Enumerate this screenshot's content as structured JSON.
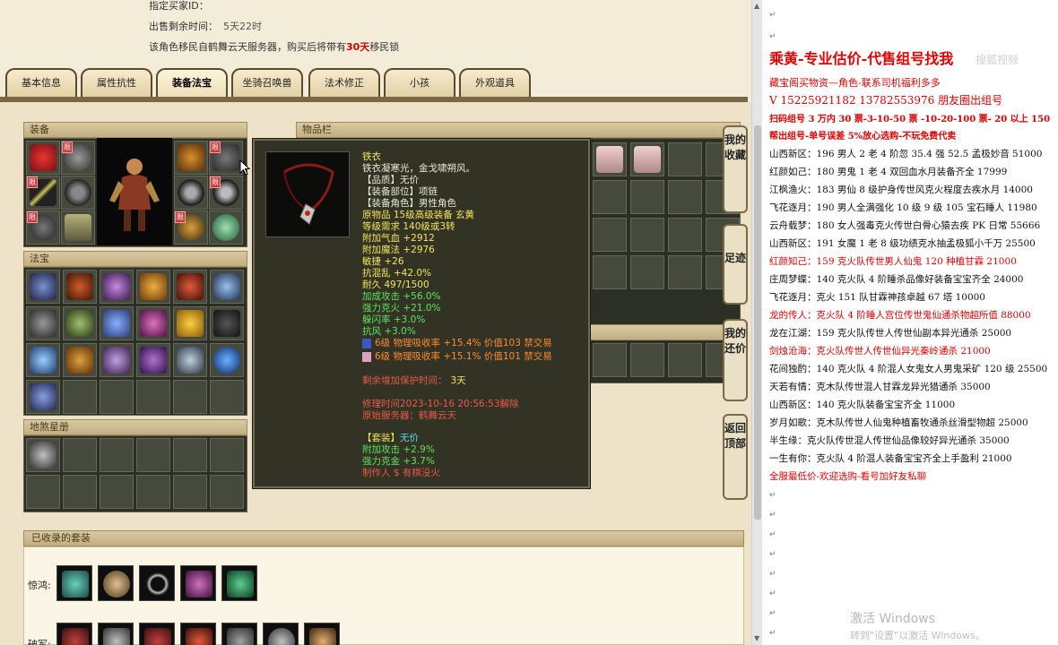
{
  "header": {
    "line0": "指定买家ID：",
    "sale_time_label": "出售剩余时间：",
    "sale_time_value": "5天22时",
    "migrate_pre": "该角色移民自鹤舞云天服务器，购买后将带有",
    "migrate_days": "30天",
    "migrate_post": "移民锁"
  },
  "tabs": [
    {
      "label": "基本信息",
      "active": false
    },
    {
      "label": "属性抗性",
      "active": false
    },
    {
      "label": "装备法宝",
      "active": true
    },
    {
      "label": "坐骑召唤兽",
      "active": false
    },
    {
      "label": "法术修正",
      "active": false
    },
    {
      "label": "小孩",
      "active": false
    },
    {
      "label": "外观道具",
      "active": false
    }
  ],
  "panels": {
    "equipment": "装备",
    "fabao": "法宝",
    "star": "地煞星册",
    "items": "物品栏",
    "suits": "已收录的套装",
    "limit_tag": "限"
  },
  "side_buttons": [
    "我的收藏",
    "足迹",
    "我的还价",
    "返回顶部"
  ],
  "tooltip": {
    "name": "铁衣",
    "desc": "铁衣凝寒光，金戈啸朔风。",
    "quality": "【品质】无价",
    "part": "【装备部位】项链",
    "role": "【装备角色】男性角色",
    "origin": "原物品 15级高级装备 玄黄",
    "level_req": "等级需求 140级或3转",
    "hp": "附加气血 +2912",
    "mp": "附加魔法 +2976",
    "agi": "敏捷 +26",
    "res_chaos": "抗混乱 +42.0%",
    "durability": "耐久 497/1500",
    "atk": "加成攻击 +56.0%",
    "fire": "强力克火 +21.0%",
    "dodge": "躲闪率 +3.0%",
    "wind": "抗风 +3.0%",
    "gem1": "6级 物理吸收率 +15.4% 价值103 禁交易",
    "gem2": "6级 物理吸收率 +15.1% 价值101 禁交易",
    "protect_label": "剩余增加保护时间：",
    "protect_value": "3天",
    "repair_time": "修理时间2023-10-16 20:56:53解除",
    "server": "原始服务器：鹤舞云天",
    "set_label": "【套装】",
    "set_value": "无价",
    "set_atk": "附加攻击 +2.9%",
    "set_gold": "强力克金 +3.7%",
    "maker": "制作人 $ 有棋没火"
  },
  "suits": {
    "row1_label": "惊鸿:",
    "row2_label": "破军:"
  },
  "overlay": {
    "title": "乘黄-专业估价-代售组号找我",
    "sub1": "藏宝阁买物资—角色-联系司机福利多多",
    "sub2": "V 15225921182   13782553976 朋友圈出组号",
    "sub3": "扫码组号 3 万内 30 票-3-10-50 票 -10-20-100 票- 20 以上 150",
    "sub4": "帮出组号-单号误差 5%放心选购-不玩免费代卖",
    "lines": [
      {
        "text": "山西新区：196 男人 2 老 4 阶忽 35.4 强 52.5 孟极妙音 51000",
        "red": false
      },
      {
        "text": "红颜如己：180 男鬼 1 老 4 双回血水月装备齐全 17999",
        "red": false
      },
      {
        "text": "江枫渔火：183 男仙 8 级护身传世风克火程度去疾水月 14000",
        "red": false
      },
      {
        "text": "飞花逐月：190 男人全满强化 10 级 9 级 105 宝石睡人 11980",
        "red": false
      },
      {
        "text": "云舟载梦：180 女人强毒克火传世白骨心猿去疾 PK 日常 55666",
        "red": false
      },
      {
        "text": "山西新区：191 女魔 1 老 8 级功绩克水抽孟极狐小千万 25500",
        "red": false
      },
      {
        "text": "红颜知己：159 克火队传世男人仙鬼 120 种植甘霖 21000",
        "red": true
      },
      {
        "text": "庄周梦蝶：140 克火队 4 阶睡杀品像好装备宝宝齐全 24000",
        "red": false
      },
      {
        "text": "飞花逐月：克火 151 队甘霖神孩卓越 67 塔 10000",
        "red": false
      },
      {
        "text": "龙的传人：克火队 4 阶睡人宫位传世鬼仙通杀物超所值 88000",
        "red": true
      },
      {
        "text": "龙在江湖：159 克火队传世人传世仙副本异光通杀 25000",
        "red": false
      },
      {
        "text": "剑烛沧海：克火队传世人传世仙异光秦岭通杀 21000",
        "red": true
      },
      {
        "text": "花间独酌：140 克火队 4 阶混人女鬼女人男鬼采矿 120 级 25500",
        "red": false
      },
      {
        "text": "天若有情：克木队传世混人甘霖龙异光猎通杀 35000",
        "red": false
      },
      {
        "text": "山西新区：140 克火队装备宝宝齐全 11000",
        "red": false
      },
      {
        "text": "岁月如歌：克木队传世人仙鬼种植畜牧通杀丝滑型物超 25000",
        "red": false
      },
      {
        "text": "半生缘：克火队传世混人传世仙品像较好异光通杀 35000",
        "red": false
      },
      {
        "text": "一生有你：克火队 4 阶混人装备宝宝齐全上手盈利 21000",
        "red": false
      },
      {
        "text": "全服最低价-欢迎选购-看号加好友私聊",
        "red": true
      }
    ],
    "wm1": "激活 Windows",
    "wm2": "转到\"设置\"以激活 Windows。",
    "wm3": "搜狐视频"
  }
}
